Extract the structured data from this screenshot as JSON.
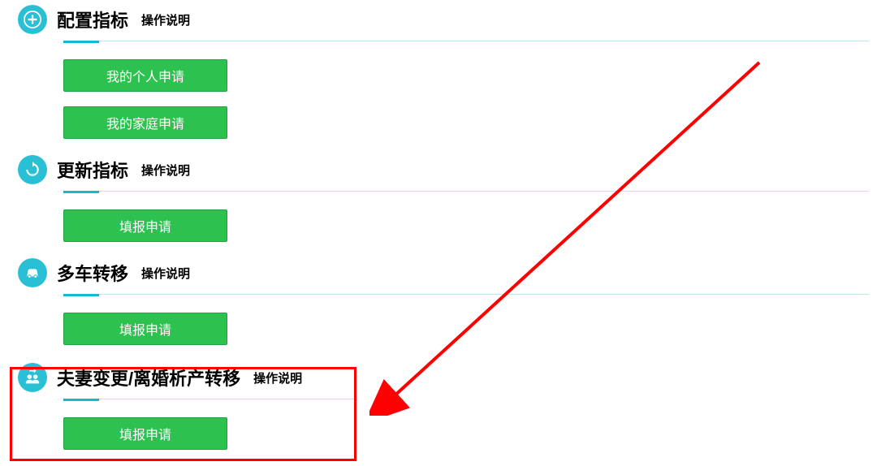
{
  "sections": [
    {
      "icon": "plus",
      "title": "配置指标",
      "hint": "操作说明",
      "buttons": [
        "我的个人申请",
        "我的家庭申请"
      ]
    },
    {
      "icon": "refresh",
      "title": "更新指标",
      "hint": "操作说明",
      "buttons": [
        "填报申请"
      ]
    },
    {
      "icon": "car",
      "title": "多车转移",
      "hint": "操作说明",
      "buttons": [
        "填报申请"
      ]
    },
    {
      "icon": "people",
      "title": "夫妻变更/离婚析产转移",
      "hint": "操作说明",
      "buttons": [
        "填报申请"
      ]
    }
  ],
  "annotations": {
    "highlight_section_index": 3,
    "arrow_target": "section-3"
  }
}
